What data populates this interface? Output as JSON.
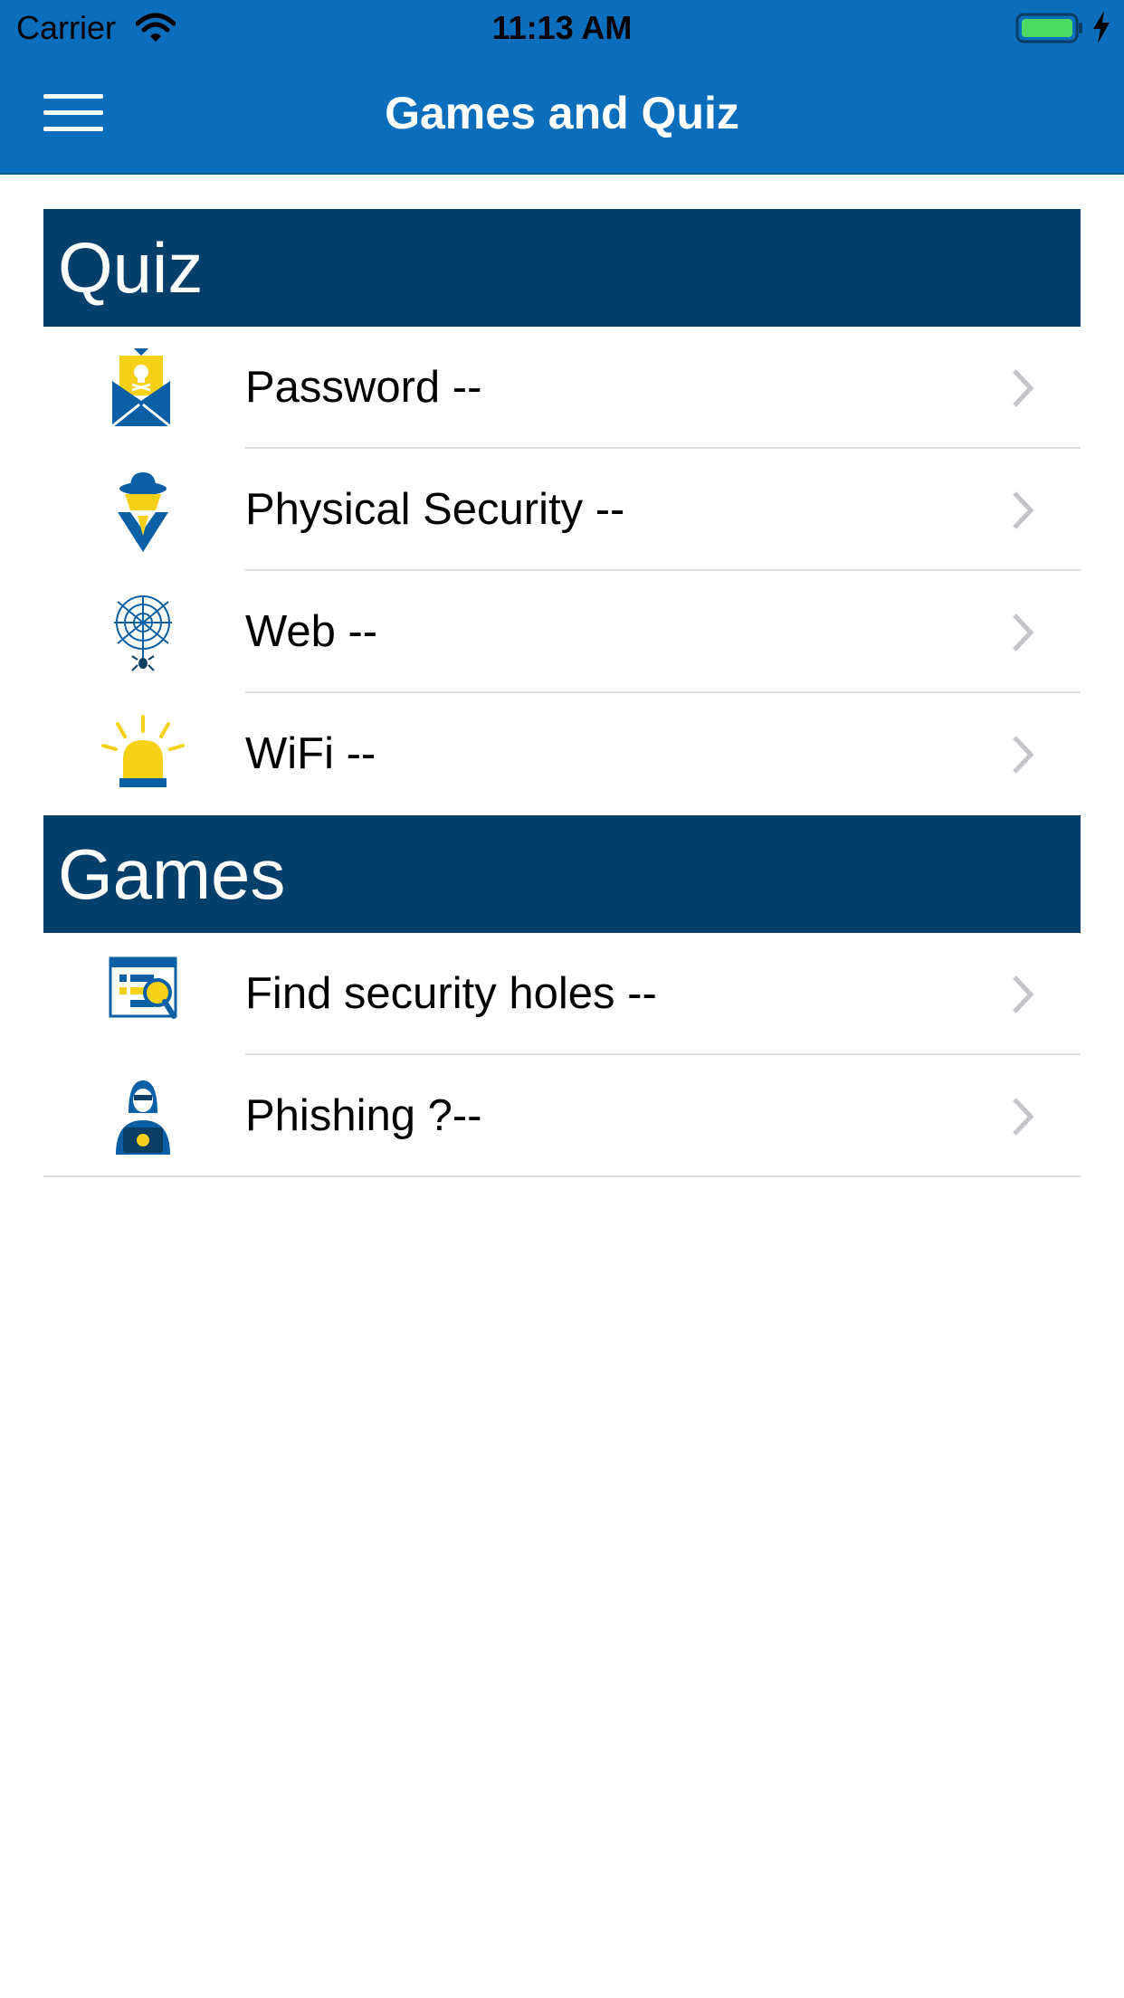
{
  "status_bar": {
    "carrier": "Carrier",
    "time": "11:13 AM"
  },
  "nav": {
    "title": "Games and Quiz"
  },
  "sections": [
    {
      "title": "Quiz",
      "items": [
        {
          "label": "Password --",
          "icon": "envelope-skull-icon"
        },
        {
          "label": "Physical Security --",
          "icon": "spy-icon"
        },
        {
          "label": "Web --",
          "icon": "spider-web-icon"
        },
        {
          "label": "WiFi --",
          "icon": "alarm-light-icon"
        }
      ]
    },
    {
      "title": "Games",
      "items": [
        {
          "label": "Find security holes --",
          "icon": "browser-magnifier-icon"
        },
        {
          "label": "Phishing ?--",
          "icon": "hacker-laptop-icon"
        }
      ]
    }
  ],
  "colors": {
    "brand_blue": "#0a6ebd",
    "section_navy": "#023f6b",
    "accent_yellow": "#f7d117"
  }
}
